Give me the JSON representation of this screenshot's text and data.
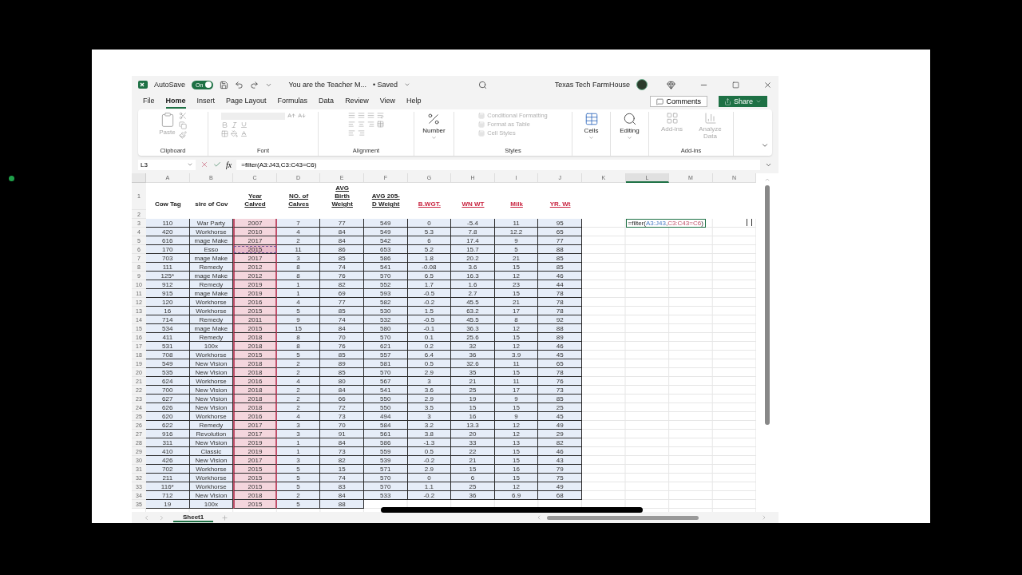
{
  "title_bar": {
    "autosave_label": "AutoSave",
    "autosave_on": true,
    "toggle_text": "On",
    "document_title": "You are the Teacher M...",
    "save_status": "• Saved",
    "account": "Texas Tech FarmHouse"
  },
  "ribbon_tabs": [
    {
      "label": "File",
      "selected": false
    },
    {
      "label": "Home",
      "selected": true
    },
    {
      "label": "Insert",
      "selected": false
    },
    {
      "label": "Page Layout",
      "selected": false
    },
    {
      "label": "Formulas",
      "selected": false
    },
    {
      "label": "Data",
      "selected": false
    },
    {
      "label": "Review",
      "selected": false
    },
    {
      "label": "View",
      "selected": false
    },
    {
      "label": "Help",
      "selected": false
    }
  ],
  "actions": {
    "comments": "Comments",
    "share": "Share"
  },
  "ribbon": {
    "paste": {
      "label": "Paste",
      "disabled": true
    },
    "clipboard_label": "Clipboard",
    "font_label": "Font",
    "alignment_label": "Alignment",
    "number_label": "Number",
    "styles_items": [
      {
        "label": "Conditional Formatting",
        "disabled": true
      },
      {
        "label": "Format as Table",
        "disabled": true
      },
      {
        "label": "Cell Styles",
        "disabled": true
      }
    ],
    "styles_label": "Styles",
    "cells_label": "Cells",
    "editing_label": "Editing",
    "addin_buttons": [
      {
        "label": "Add-ins",
        "disabled": true
      },
      {
        "label": "Analyze Data",
        "disabled": true
      }
    ],
    "addins_label": "Add-ins"
  },
  "formula_bar": {
    "name_box": "L3",
    "function_label": "fx",
    "formula": "=filter(A3:J43,C3:C43=C6)"
  },
  "columns": [
    {
      "letter": "A",
      "header_lines": [
        "Cow Tag"
      ],
      "kind": "bold",
      "criteria_range": false,
      "selected": false
    },
    {
      "letter": "B",
      "header_lines": [
        "sire of Cov"
      ],
      "kind": "bold",
      "criteria_range": false,
      "selected": false
    },
    {
      "letter": "C",
      "header_lines": [
        "Year",
        "Calved"
      ],
      "kind": "underlined",
      "criteria_range": true,
      "selected": false
    },
    {
      "letter": "D",
      "header_lines": [
        "NO. of",
        "Calves"
      ],
      "kind": "underlined",
      "criteria_range": false,
      "selected": false
    },
    {
      "letter": "E",
      "header_lines": [
        "AVG",
        "Birth",
        "Weight"
      ],
      "kind": "underlined",
      "criteria_range": false,
      "selected": false
    },
    {
      "letter": "F",
      "header_lines": [
        "AVG 205-",
        "D Weight"
      ],
      "kind": "underlined",
      "criteria_range": false,
      "selected": false
    },
    {
      "letter": "G",
      "header_lines": [
        "B.WGT."
      ],
      "kind": "accent",
      "criteria_range": false,
      "selected": false
    },
    {
      "letter": "H",
      "header_lines": [
        "WN WT"
      ],
      "kind": "accent",
      "criteria_range": false,
      "selected": false
    },
    {
      "letter": "I",
      "header_lines": [
        "Milk"
      ],
      "kind": "accent",
      "criteria_range": false,
      "selected": false
    },
    {
      "letter": "J",
      "header_lines": [
        "YR. Wt"
      ],
      "kind": "accent",
      "criteria_range": false,
      "selected": false
    },
    {
      "letter": "K",
      "selected": false
    },
    {
      "letter": "L",
      "selected": true
    },
    {
      "letter": "M",
      "selected": false
    },
    {
      "letter": "N",
      "selected": false
    }
  ],
  "header_row_number": "1",
  "blank_row_number": "2",
  "rows": [
    {
      "number": "3",
      "criteria_cell": false,
      "cells": [
        "110",
        "War Party",
        "2007",
        "7",
        "77",
        "549",
        "0",
        "-5.4",
        "11",
        "95"
      ],
      "formula_entry": [
        {
          "text": "=filter(",
          "kind": "plain"
        },
        {
          "text": "A3:J43",
          "kind": "range"
        },
        {
          "text": ",",
          "kind": "plain"
        },
        {
          "text": "C3:C43=C6",
          "kind": "criteria"
        },
        {
          "text": ")",
          "kind": "plain"
        }
      ]
    },
    {
      "number": "4",
      "criteria_cell": false,
      "cells": [
        "420",
        "Workhorse",
        "2010",
        "4",
        "84",
        "549",
        "5.3",
        "7.8",
        "12.2",
        "65"
      ]
    },
    {
      "number": "5",
      "criteria_cell": false,
      "cells": [
        "616",
        "mage Make",
        "2017",
        "2",
        "84",
        "542",
        "6",
        "17.4",
        "9",
        "77"
      ]
    },
    {
      "number": "6",
      "criteria_cell": true,
      "cells": [
        "170",
        "Esso",
        "2015",
        "11",
        "86",
        "653",
        "5.2",
        "15.7",
        "5",
        "88"
      ]
    },
    {
      "number": "7",
      "criteria_cell": false,
      "cells": [
        "703",
        "mage Make",
        "2017",
        "3",
        "85",
        "586",
        "1.8",
        "20.2",
        "21",
        "85"
      ]
    },
    {
      "number": "8",
      "criteria_cell": false,
      "cells": [
        "111",
        "Remedy",
        "2012",
        "8",
        "74",
        "541",
        "-0.08",
        "3.6",
        "15",
        "85"
      ]
    },
    {
      "number": "9",
      "criteria_cell": false,
      "cells": [
        "125*",
        "mage Make",
        "2012",
        "8",
        "76",
        "570",
        "6.5",
        "16.3",
        "12",
        "46"
      ]
    },
    {
      "number": "10",
      "criteria_cell": false,
      "cells": [
        "912",
        "Remedy",
        "2019",
        "1",
        "82",
        "552",
        "1.7",
        "1.6",
        "23",
        "44"
      ]
    },
    {
      "number": "11",
      "criteria_cell": false,
      "cells": [
        "915",
        "mage Make",
        "2019",
        "1",
        "69",
        "593",
        "-0.5",
        "2.7",
        "15",
        "78"
      ]
    },
    {
      "number": "12",
      "criteria_cell": false,
      "cells": [
        "120",
        "Workhorse",
        "2016",
        "4",
        "77",
        "582",
        "-0.2",
        "45.5",
        "21",
        "78"
      ]
    },
    {
      "number": "13",
      "criteria_cell": false,
      "cells": [
        "16",
        "Workhorse",
        "2015",
        "5",
        "85",
        "530",
        "1.5",
        "63.2",
        "17",
        "78"
      ]
    },
    {
      "number": "14",
      "criteria_cell": false,
      "cells": [
        "714",
        "Remedy",
        "2011",
        "9",
        "74",
        "532",
        "-0.5",
        "45.5",
        "8",
        "92"
      ]
    },
    {
      "number": "15",
      "criteria_cell": false,
      "cells": [
        "534",
        "mage Make",
        "2015",
        "15",
        "84",
        "580",
        "-0.1",
        "36.3",
        "12",
        "88"
      ]
    },
    {
      "number": "16",
      "criteria_cell": false,
      "cells": [
        "411",
        "Remedy",
        "2018",
        "8",
        "70",
        "570",
        "0.1",
        "25.6",
        "15",
        "89"
      ]
    },
    {
      "number": "17",
      "criteria_cell": false,
      "cells": [
        "531",
        "100x",
        "2018",
        "8",
        "76",
        "621",
        "0.2",
        "32",
        "12",
        "46"
      ]
    },
    {
      "number": "18",
      "criteria_cell": false,
      "cells": [
        "708",
        "Workhorse",
        "2015",
        "5",
        "85",
        "557",
        "6.4",
        "36",
        "3.9",
        "45"
      ]
    },
    {
      "number": "19",
      "criteria_cell": false,
      "cells": [
        "549",
        "New Vision",
        "2018",
        "2",
        "89",
        "581",
        "0.5",
        "32.6",
        "11",
        "65"
      ]
    },
    {
      "number": "20",
      "criteria_cell": false,
      "cells": [
        "535",
        "New Vision",
        "2018",
        "2",
        "85",
        "570",
        "2.9",
        "35",
        "15",
        "78"
      ]
    },
    {
      "number": "21",
      "criteria_cell": false,
      "cells": [
        "624",
        "Workhorse",
        "2016",
        "4",
        "80",
        "567",
        "3",
        "21",
        "11",
        "76"
      ]
    },
    {
      "number": "22",
      "criteria_cell": false,
      "cells": [
        "700",
        "New Vision",
        "2018",
        "2",
        "84",
        "541",
        "3.6",
        "25",
        "17",
        "73"
      ]
    },
    {
      "number": "23",
      "criteria_cell": false,
      "cells": [
        "627",
        "New Vision",
        "2018",
        "2",
        "66",
        "550",
        "2.9",
        "19",
        "9",
        "85"
      ]
    },
    {
      "number": "24",
      "criteria_cell": false,
      "cells": [
        "626",
        "New Vision",
        "2018",
        "2",
        "72",
        "550",
        "3.5",
        "15",
        "15",
        "25"
      ]
    },
    {
      "number": "25",
      "criteria_cell": false,
      "cells": [
        "620",
        "Workhorse",
        "2016",
        "4",
        "73",
        "494",
        "3",
        "16",
        "9",
        "45"
      ]
    },
    {
      "number": "26",
      "criteria_cell": false,
      "cells": [
        "622",
        "Remedy",
        "2017",
        "3",
        "70",
        "584",
        "3.2",
        "13.3",
        "12",
        "49"
      ]
    },
    {
      "number": "27",
      "criteria_cell": false,
      "cells": [
        "916",
        "Revolution",
        "2017",
        "3",
        "91",
        "561",
        "3.8",
        "20",
        "12",
        "29"
      ]
    },
    {
      "number": "28",
      "criteria_cell": false,
      "cells": [
        "311",
        "New Vision",
        "2019",
        "1",
        "84",
        "586",
        "-1.3",
        "33",
        "13",
        "82"
      ]
    },
    {
      "number": "29",
      "criteria_cell": false,
      "cells": [
        "410",
        "Classic",
        "2019",
        "1",
        "73",
        "559",
        "0.5",
        "22",
        "15",
        "46"
      ]
    },
    {
      "number": "30",
      "criteria_cell": false,
      "cells": [
        "426",
        "New Vision",
        "2017",
        "3",
        "82",
        "539",
        "-0.2",
        "21",
        "15",
        "43"
      ]
    },
    {
      "number": "31",
      "criteria_cell": false,
      "cells": [
        "702",
        "Workhorse",
        "2015",
        "5",
        "15",
        "571",
        "2.9",
        "15",
        "16",
        "79"
      ]
    },
    {
      "number": "32",
      "criteria_cell": false,
      "cells": [
        "211",
        "Workhorse",
        "2015",
        "5",
        "74",
        "570",
        "0",
        "6",
        "15",
        "75"
      ]
    },
    {
      "number": "33",
      "criteria_cell": false,
      "cells": [
        "116*",
        "Workhorse",
        "2015",
        "5",
        "83",
        "570",
        "1.1",
        "25",
        "12",
        "49"
      ]
    },
    {
      "number": "34",
      "criteria_cell": false,
      "cells": [
        "712",
        "New Vision",
        "2018",
        "2",
        "84",
        "533",
        "-0.2",
        "36",
        "6.9",
        "68"
      ]
    },
    {
      "number": "35",
      "criteria_cell": false,
      "cells": [
        "19",
        "100x",
        "2015",
        "5",
        "88"
      ]
    }
  ],
  "sheet_tabs": [
    {
      "label": "Sheet1",
      "selected": true
    }
  ]
}
